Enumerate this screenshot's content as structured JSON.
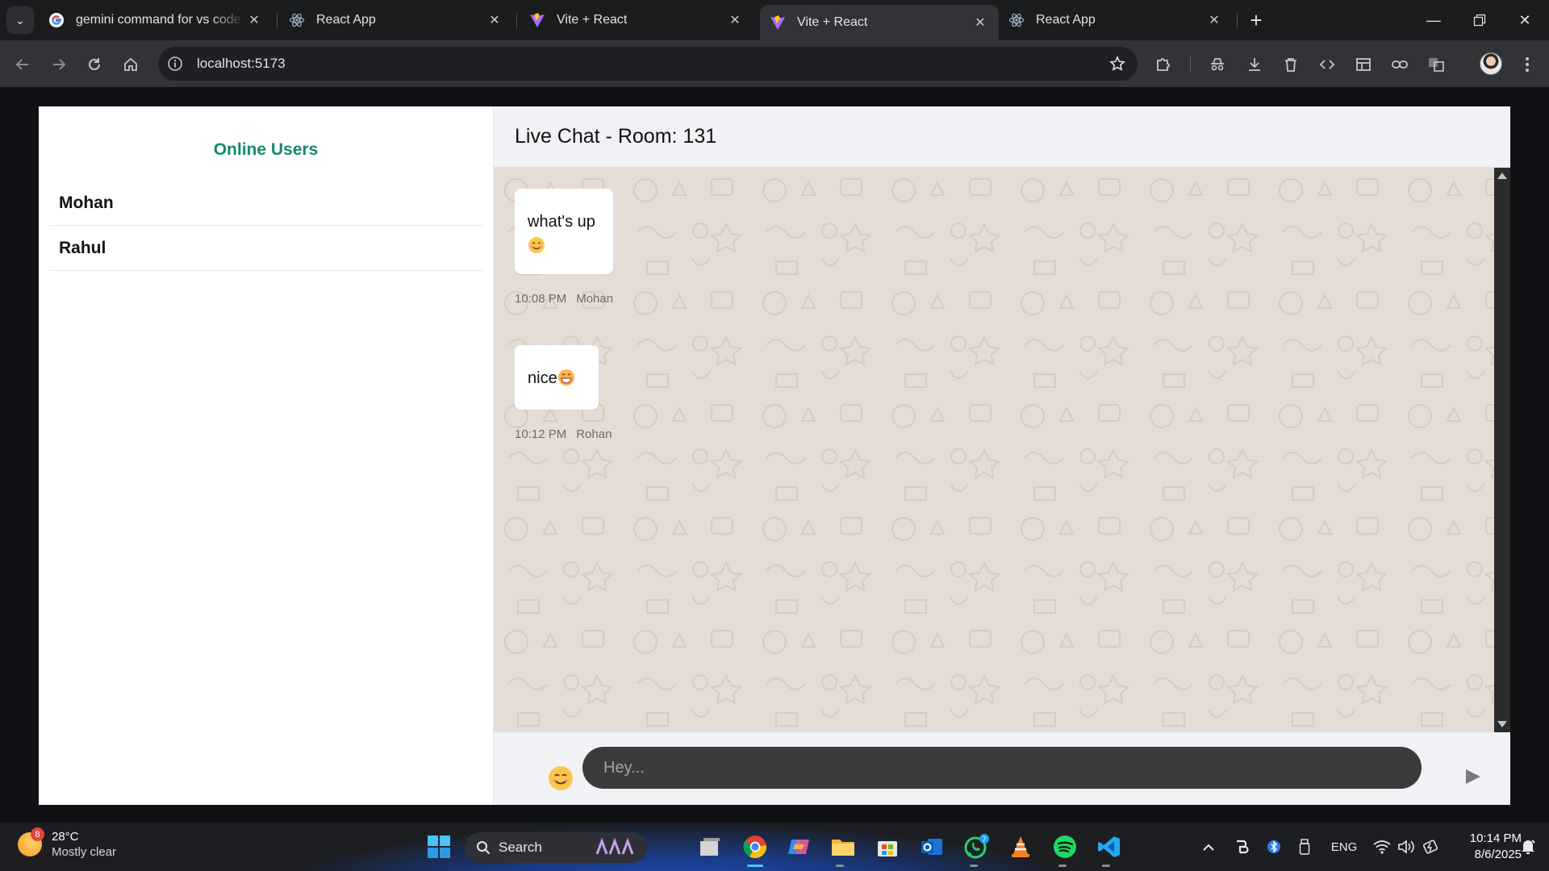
{
  "browser": {
    "tabs": [
      {
        "title": "gemini command for vs code te",
        "favicon": "google-icon",
        "active": false
      },
      {
        "title": "React App",
        "favicon": "react-icon",
        "active": false
      },
      {
        "title": "Vite + React",
        "favicon": "vite-icon",
        "active": false
      },
      {
        "title": "Vite + React",
        "favicon": "vite-icon",
        "active": true
      },
      {
        "title": "React App",
        "favicon": "react-icon",
        "active": false
      }
    ],
    "url": "localhost:5173"
  },
  "app": {
    "sidebar": {
      "title": "Online Users",
      "users": [
        "Mohan",
        "Rahul"
      ]
    },
    "chat": {
      "header": "Live Chat - Room: 131",
      "messages": [
        {
          "text_line1": "what's up",
          "text_line2": "",
          "time": "10:08 PM",
          "author": "Mohan",
          "emoji": "smiling-face"
        },
        {
          "text_line1": "nice",
          "text_line2": "",
          "time": "10:12 PM",
          "author": "Rohan",
          "emoji": "grinning-face"
        }
      ],
      "input_placeholder": "Hey...",
      "colors": {
        "accent": "#128c6e",
        "wallpaper": "#e5ddd5",
        "input_bg": "#3b3b3b",
        "composer_bg": "#f0f2f5"
      }
    }
  },
  "taskbar": {
    "weather": {
      "temp": "28°C",
      "condition": "Mostly clear",
      "badge": "8"
    },
    "search_label": "Search",
    "whatsapp_badge": "7",
    "language": "ENG",
    "time": "10:14 PM",
    "date": "8/6/2025"
  }
}
